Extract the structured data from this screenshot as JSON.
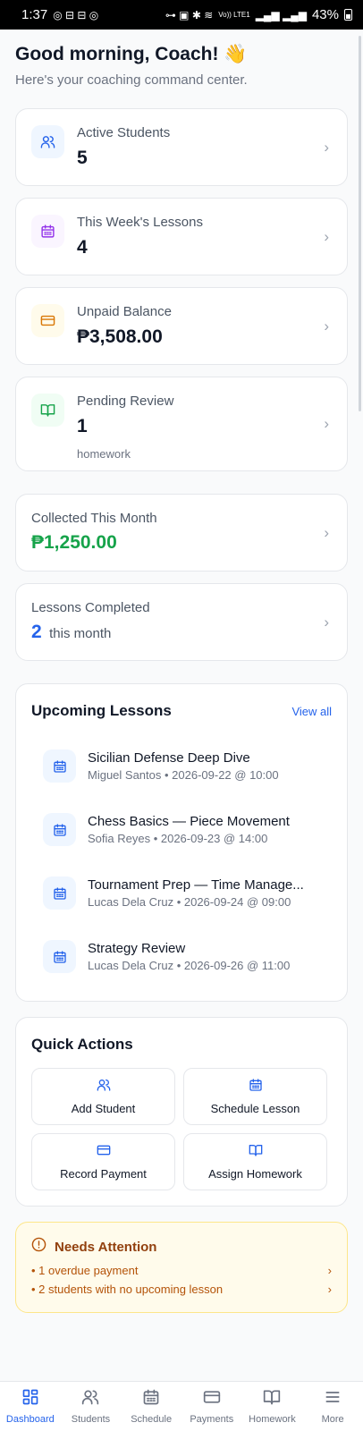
{
  "status_bar": {
    "time": "1:37",
    "battery": "43%",
    "network": "Vo)) LTE1"
  },
  "greeting": {
    "title": "Good morning, Coach! 👋",
    "subtitle": "Here's your coaching command center."
  },
  "stats": [
    {
      "label": "Active Students",
      "value": "5",
      "icon": "users-icon",
      "tile_color": "#eff6ff",
      "icon_color": "#2563eb"
    },
    {
      "label": "This Week's Lessons",
      "value": "4",
      "icon": "calendar-icon",
      "tile_color": "#faf5ff",
      "icon_color": "#9333ea"
    },
    {
      "label": "Unpaid Balance",
      "value": "₱3,508.00",
      "icon": "credit-card-icon",
      "tile_color": "#fffbeb",
      "icon_color": "#d97706"
    },
    {
      "label": "Pending Review",
      "value": "1",
      "sub": "homework",
      "icon": "book-icon",
      "tile_color": "#f0fdf4",
      "icon_color": "#16a34a"
    }
  ],
  "collected": {
    "label": "Collected This Month",
    "value": "₱1,250.00"
  },
  "completed": {
    "label": "Lessons Completed",
    "value": "2",
    "suffix": "this month"
  },
  "upcoming": {
    "title": "Upcoming Lessons",
    "view_all": "View all",
    "lessons": [
      {
        "title": "Sicilian Defense Deep Dive",
        "meta": "Miguel Santos • 2026-09-22 @ 10:00"
      },
      {
        "title": "Chess Basics — Piece Movement",
        "meta": "Sofia Reyes • 2026-09-23 @ 14:00"
      },
      {
        "title": "Tournament Prep — Time Manage...",
        "meta": "Lucas Dela Cruz • 2026-09-24 @ 09:00"
      },
      {
        "title": "Strategy Review",
        "meta": "Lucas Dela Cruz • 2026-09-26 @ 11:00"
      }
    ]
  },
  "quick_actions": {
    "title": "Quick Actions",
    "items": [
      {
        "label": "Add Student",
        "icon": "users-icon"
      },
      {
        "label": "Schedule Lesson",
        "icon": "calendar-icon"
      },
      {
        "label": "Record Payment",
        "icon": "credit-card-icon"
      },
      {
        "label": "Assign Homework",
        "icon": "book-icon"
      }
    ]
  },
  "attention": {
    "title": "Needs Attention",
    "items": [
      "• 1 overdue payment",
      "• 2 students with no upcoming lesson"
    ]
  },
  "tabs": [
    {
      "label": "Dashboard",
      "icon": "grid-icon",
      "active": true
    },
    {
      "label": "Students",
      "icon": "users-icon"
    },
    {
      "label": "Schedule",
      "icon": "calendar-icon"
    },
    {
      "label": "Payments",
      "icon": "credit-card-icon"
    },
    {
      "label": "Homework",
      "icon": "book-icon"
    },
    {
      "label": "More",
      "icon": "menu-icon"
    }
  ],
  "colors": {
    "accent": "#2563eb",
    "success": "#16a34a",
    "warning": "#b45309",
    "muted": "#6b7280"
  }
}
